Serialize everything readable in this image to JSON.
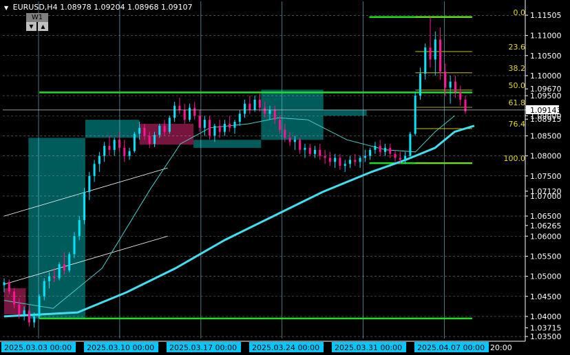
{
  "header": {
    "symbol": "EURUSD,H4",
    "ohlc": "1.08978 1.09204 1.08968 1.09107",
    "timeframe_button": "W1",
    "down_glyph": "▼",
    "up_glyph": "▲"
  },
  "colors": {
    "background": "#000000",
    "grid": "#bfbfbf",
    "bull": "#00e5ff",
    "bear": "#ff1493",
    "ma_fast": "#48d1cc",
    "ma_slow": "#40e0f0",
    "fib": "#e6d820",
    "level_line": "#22dd22",
    "box_teal": "#006b6b",
    "box_magenta": "#8b1a4a",
    "axis_text": "#ffffff",
    "bid_label_bg": "#ffffff",
    "date_label_bg": "#00c8ff"
  },
  "chart_data": {
    "type": "candlestick",
    "symbol": "EURUSD",
    "timeframe": "H4",
    "ylim": [
      1.0345,
      1.1185
    ],
    "y_ticks": [
      1.115,
      1.11,
      1.105,
      1.1,
      1.095,
      1.09,
      1.085,
      1.08,
      1.075,
      1.07,
      1.065,
      1.06,
      1.055,
      1.05,
      1.045,
      1.04,
      1.035
    ],
    "y_tick_labels": [
      "1.11505",
      "1.11000",
      "1.10500",
      "1.10000",
      "1.09670",
      "1.09500",
      "1.09143",
      "1.09000",
      "1.08915",
      "1.08500",
      "1.08000",
      "1.07500",
      "1.07120",
      "1.07000",
      "1.06500",
      "1.06265",
      "1.06000",
      "1.05500",
      "1.05000",
      "1.04500",
      "1.04000",
      "1.03715",
      "1.03500"
    ],
    "y_label_values": [
      1.11505,
      1.11,
      1.105,
      1.1,
      1.0967,
      1.095,
      1.09143,
      1.09,
      1.08915,
      1.085,
      1.08,
      1.075,
      1.0712,
      1.07,
      1.065,
      1.06265,
      1.06,
      1.055,
      1.05,
      1.045,
      1.04,
      1.03715,
      1.035
    ],
    "x_labels": [
      "2025.03.03 00:00",
      "2025.03.10 00:00",
      "2025.03.17 00:00",
      "2025.03.24 00:00",
      "2025.03.31 00:00",
      "2025.04.07 00:00"
    ],
    "x_label_trailing": "20:00",
    "bars_per_week": 30,
    "current_bid": 1.09143,
    "candles": [
      [
        1.0478,
        1.0495,
        1.046,
        1.0485
      ],
      [
        1.0485,
        1.0492,
        1.0455,
        1.0462
      ],
      [
        1.0462,
        1.047,
        1.042,
        1.043
      ],
      [
        1.043,
        1.0445,
        1.0395,
        1.0405
      ],
      [
        1.0405,
        1.0425,
        1.039,
        1.0415
      ],
      [
        1.0415,
        1.043,
        1.0375,
        1.0385
      ],
      [
        1.0385,
        1.041,
        1.0372,
        1.04
      ],
      [
        1.04,
        1.0455,
        1.0395,
        1.045
      ],
      [
        1.045,
        1.0495,
        1.044,
        1.0488
      ],
      [
        1.0488,
        1.051,
        1.047,
        1.05
      ],
      [
        1.05,
        1.052,
        1.0485,
        1.0495
      ],
      [
        1.0495,
        1.0535,
        1.049,
        1.053
      ],
      [
        1.053,
        1.056,
        1.0505,
        1.0515
      ],
      [
        1.0515,
        1.056,
        1.051,
        1.0555
      ],
      [
        1.0555,
        1.061,
        1.0545,
        1.06
      ],
      [
        1.06,
        1.065,
        1.059,
        1.064
      ],
      [
        1.064,
        1.072,
        1.063,
        1.071
      ],
      [
        1.071,
        1.076,
        1.069,
        1.075
      ],
      [
        1.075,
        1.079,
        1.0735,
        1.078
      ],
      [
        1.078,
        1.081,
        1.076,
        1.08
      ],
      [
        1.08,
        1.0835,
        1.0785,
        1.0825
      ],
      [
        1.0825,
        1.085,
        1.08,
        1.0815
      ],
      [
        1.0815,
        1.0845,
        1.08,
        1.084
      ],
      [
        1.084,
        1.086,
        1.081,
        1.082
      ],
      [
        1.082,
        1.084,
        1.0785,
        1.08
      ],
      [
        1.08,
        1.082,
        1.079,
        1.0812
      ],
      [
        1.0812,
        1.086,
        1.0808,
        1.0855
      ],
      [
        1.0855,
        1.0885,
        1.084,
        1.087
      ],
      [
        1.087,
        1.088,
        1.084,
        1.085
      ],
      [
        1.085,
        1.086,
        1.082,
        1.083
      ],
      [
        1.083,
        1.086,
        1.0822,
        1.0852
      ],
      [
        1.0852,
        1.088,
        1.0845,
        1.0875
      ],
      [
        1.0875,
        1.089,
        1.085,
        1.086
      ],
      [
        1.086,
        1.09,
        1.0855,
        1.0895
      ],
      [
        1.0895,
        1.0935,
        1.0885,
        1.0925
      ],
      [
        1.0925,
        1.0945,
        1.0905,
        1.0915
      ],
      [
        1.0915,
        1.093,
        1.088,
        1.089
      ],
      [
        1.089,
        1.093,
        1.0885,
        1.092
      ],
      [
        1.092,
        1.0935,
        1.089,
        1.09
      ],
      [
        1.09,
        1.0915,
        1.086,
        1.087
      ],
      [
        1.087,
        1.09,
        1.085,
        1.089
      ],
      [
        1.089,
        1.09,
        1.084,
        1.085
      ],
      [
        1.085,
        1.088,
        1.0835,
        1.0875
      ],
      [
        1.0875,
        1.089,
        1.0845,
        1.086
      ],
      [
        1.086,
        1.089,
        1.085,
        1.088
      ],
      [
        1.088,
        1.09,
        1.086,
        1.087
      ],
      [
        1.087,
        1.089,
        1.0855,
        1.0885
      ],
      [
        1.0885,
        1.0915,
        1.0875,
        1.0905
      ],
      [
        1.0905,
        1.094,
        1.0895,
        1.093
      ],
      [
        1.093,
        1.095,
        1.0905,
        1.0915
      ],
      [
        1.0915,
        1.095,
        1.091,
        1.094
      ],
      [
        1.094,
        1.0955,
        1.091,
        1.092
      ],
      [
        1.092,
        1.0935,
        1.0895,
        1.0905
      ],
      [
        1.0905,
        1.0925,
        1.089,
        1.0915
      ],
      [
        1.0915,
        1.0925,
        1.088,
        1.089
      ],
      [
        1.089,
        1.09,
        1.0855,
        1.0865
      ],
      [
        1.0865,
        1.088,
        1.0835,
        1.0845
      ],
      [
        1.0845,
        1.086,
        1.0825,
        1.0835
      ],
      [
        1.0835,
        1.085,
        1.0815,
        1.084
      ],
      [
        1.084,
        1.0845,
        1.0805,
        1.0815
      ],
      [
        1.0815,
        1.083,
        1.0795,
        1.082
      ],
      [
        1.082,
        1.083,
        1.08,
        1.0805
      ],
      [
        1.0805,
        1.0825,
        1.0795,
        1.0815
      ],
      [
        1.0815,
        1.083,
        1.079,
        1.08
      ],
      [
        1.08,
        1.0815,
        1.078,
        1.0795
      ],
      [
        1.0795,
        1.081,
        1.0775,
        1.0785
      ],
      [
        1.0785,
        1.0805,
        1.077,
        1.0795
      ],
      [
        1.0795,
        1.0805,
        1.0765,
        1.0775
      ],
      [
        1.0775,
        1.079,
        1.076,
        1.078
      ],
      [
        1.078,
        1.08,
        1.077,
        1.079
      ],
      [
        1.079,
        1.0805,
        1.0775,
        1.0785
      ],
      [
        1.0785,
        1.08,
        1.077,
        1.0795
      ],
      [
        1.0795,
        1.0815,
        1.0785,
        1.08
      ],
      [
        1.08,
        1.082,
        1.079,
        1.0815
      ],
      [
        1.0815,
        1.0835,
        1.0805,
        1.0825
      ],
      [
        1.0825,
        1.084,
        1.08,
        1.081
      ],
      [
        1.081,
        1.083,
        1.08,
        1.082
      ],
      [
        1.082,
        1.083,
        1.0795,
        1.0805
      ],
      [
        1.0805,
        1.0815,
        1.0785,
        1.0795
      ],
      [
        1.0795,
        1.081,
        1.078,
        1.079
      ],
      [
        1.079,
        1.081,
        1.078,
        1.08
      ],
      [
        1.08,
        1.086,
        1.0795,
        1.0855
      ],
      [
        1.0855,
        1.096,
        1.085,
        1.095
      ],
      [
        1.095,
        1.102,
        1.094,
        1.1005
      ],
      [
        1.1005,
        1.108,
        1.099,
        1.107
      ],
      [
        1.107,
        1.1146,
        1.102,
        1.104
      ],
      [
        1.104,
        1.111,
        1.1,
        1.109
      ],
      [
        1.109,
        1.112,
        1.099,
        1.101
      ],
      [
        1.101,
        1.103,
        1.095,
        1.097
      ],
      [
        1.097,
        1.1,
        1.093,
        1.0985
      ],
      [
        1.0985,
        1.1,
        1.0945,
        1.096
      ],
      [
        1.096,
        1.0975,
        1.0925,
        1.094
      ],
      [
        1.094,
        1.095,
        1.0905,
        1.0911
      ]
    ],
    "ma_fast": [
      [
        0,
        1.044
      ],
      [
        10,
        1.042
      ],
      [
        20,
        1.052
      ],
      [
        30,
        1.072
      ],
      [
        36,
        1.083
      ],
      [
        42,
        1.087
      ],
      [
        50,
        1.088
      ],
      [
        56,
        1.0895
      ],
      [
        62,
        1.089
      ],
      [
        70,
        1.084
      ],
      [
        78,
        1.0815
      ],
      [
        84,
        1.081
      ],
      [
        88,
        1.086
      ],
      [
        92,
        1.09
      ]
    ],
    "ma_slow": [
      [
        0,
        1.04
      ],
      [
        15,
        1.041
      ],
      [
        25,
        1.046
      ],
      [
        35,
        1.052
      ],
      [
        45,
        1.059
      ],
      [
        55,
        1.065
      ],
      [
        65,
        1.071
      ],
      [
        75,
        1.076
      ],
      [
        82,
        1.079
      ],
      [
        88,
        1.082
      ],
      [
        92,
        1.086
      ],
      [
        96,
        1.0875
      ]
    ],
    "fibonacci": {
      "high": 1.1146,
      "low": 1.0782,
      "levels": [
        {
          "label": "0.0",
          "value": 1.1146
        },
        {
          "label": "23.6",
          "value": 1.106
        },
        {
          "label": "38.2",
          "value": 1.1007
        },
        {
          "label": "50.0",
          "value": 1.0964
        },
        {
          "label": "61.8",
          "value": 1.0921
        },
        {
          "label": "76.4",
          "value": 1.0868
        },
        {
          "label": "100.0",
          "value": 1.0782
        }
      ]
    },
    "green_levels": [
      1.1146,
      1.0958,
      1.0782,
      1.0395
    ],
    "trend_channel": [
      {
        "from": [
          0,
          1.065
        ],
        "to": [
          39,
          1.077
        ]
      },
      {
        "from": [
          0,
          1.048
        ],
        "to": [
          39,
          1.06
        ]
      }
    ],
    "boxes": [
      {
        "kind": "teal",
        "from_bar": 9,
        "to_bar": 30,
        "high": 1.0845,
        "low": 1.0395
      },
      {
        "kind": "teal",
        "from_bar": 30,
        "to_bar": 50,
        "high": 1.089,
        "low": 1.0845
      },
      {
        "kind": "magenta",
        "from_bar": 50,
        "to_bar": 70,
        "high": 1.088,
        "low": 1.0828
      },
      {
        "kind": "teal",
        "from_bar": 70,
        "to_bar": 95,
        "high": 1.084,
        "low": 1.082
      },
      {
        "kind": "teal",
        "from_bar": 95,
        "to_bar": 118,
        "high": 1.0965,
        "low": 1.084
      },
      {
        "kind": "teal",
        "from_bar": 118,
        "to_bar": 134,
        "high": 1.0915,
        "low": 1.09
      },
      {
        "kind": "magenta",
        "from_bar": 0,
        "to_bar": 8,
        "high": 1.047,
        "low": 1.0405
      }
    ]
  }
}
